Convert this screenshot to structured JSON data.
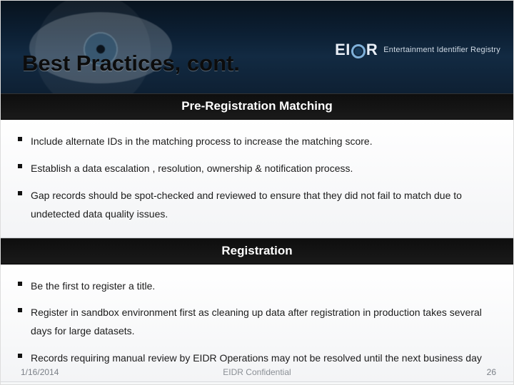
{
  "header": {
    "title": "Best Practices, cont.",
    "logo_text_left": "EI",
    "logo_text_right": "R",
    "logo_subtitle": "Entertainment Identifier Registry"
  },
  "sections": [
    {
      "heading": "Pre-Registration Matching",
      "items": [
        "Include alternate IDs in the matching process to increase the matching score.",
        "Establish a data escalation , resolution,  ownership & notification process.",
        "Gap records should be spot-checked and reviewed  to ensure that they did not fail to match due to undetected data quality issues."
      ]
    },
    {
      "heading": "Registration",
      "items": [
        "Be the first to register a title.",
        "Register in sandbox environment first as cleaning up data after registration in production takes several days for large datasets.",
        "Records requiring manual review by EIDR Operations may not be resolved until the next business day"
      ]
    }
  ],
  "footer": {
    "date": "1/16/2014",
    "center": "EIDR Confidential",
    "page": "26"
  }
}
